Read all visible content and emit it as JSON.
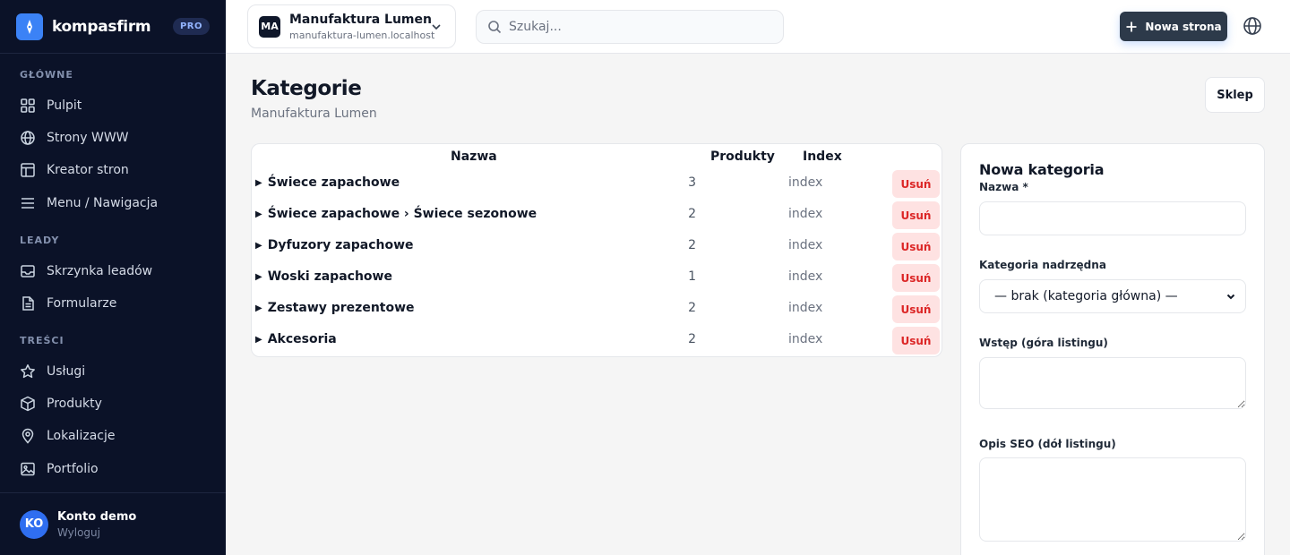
{
  "brand": {
    "name": "kompasfirm",
    "badge": "PRO"
  },
  "sidebar": {
    "sections": [
      {
        "title": "GŁÓWNE",
        "items": [
          {
            "label": "Pulpit",
            "icon": "grid-icon"
          },
          {
            "label": "Strony WWW",
            "icon": "globe-icon"
          },
          {
            "label": "Kreator stron",
            "icon": "layout-icon"
          },
          {
            "label": "Menu / Nawigacja",
            "icon": "menu-icon"
          }
        ]
      },
      {
        "title": "LEADY",
        "items": [
          {
            "label": "Skrzynka leadów",
            "icon": "inbox-icon"
          },
          {
            "label": "Formularze",
            "icon": "document-icon"
          }
        ]
      },
      {
        "title": "TREŚCI",
        "items": [
          {
            "label": "Usługi",
            "icon": "star-icon"
          },
          {
            "label": "Produkty",
            "icon": "box-icon"
          },
          {
            "label": "Lokalizacje",
            "icon": "map-pin-icon"
          },
          {
            "label": "Portfolio",
            "icon": "image-icon"
          }
        ]
      }
    ],
    "user": {
      "initials": "KO",
      "name": "Konto demo",
      "logout": "Wyloguj"
    }
  },
  "topbar": {
    "site": {
      "initials": "MA",
      "name": "Manufaktura Lumen",
      "domain": "manufaktura-lumen.localhost"
    },
    "search_placeholder": "Szukaj...",
    "new_page_label": "Nowa strona"
  },
  "page": {
    "title": "Kategorie",
    "subtitle": "Manufaktura Lumen",
    "shop_button": "Sklep"
  },
  "table": {
    "headers": {
      "name": "Nazwa",
      "products": "Produkty",
      "index": "Index"
    },
    "rows": [
      {
        "name": "Świece zapachowe",
        "products": "3",
        "index": "index",
        "action": "Usuń"
      },
      {
        "name": "Świece zapachowe › Świece sezonowe",
        "products": "2",
        "index": "index",
        "action": "Usuń"
      },
      {
        "name": "Dyfuzory zapachowe",
        "products": "2",
        "index": "index",
        "action": "Usuń"
      },
      {
        "name": "Woski zapachowe",
        "products": "1",
        "index": "index",
        "action": "Usuń"
      },
      {
        "name": "Zestawy prezentowe",
        "products": "2",
        "index": "index",
        "action": "Usuń"
      },
      {
        "name": "Akcesoria",
        "products": "2",
        "index": "index",
        "action": "Usuń"
      }
    ]
  },
  "form": {
    "title": "Nowa kategoria",
    "name_label": "Nazwa *",
    "name_value": "",
    "parent_label": "Kategoria nadrzędna",
    "parent_selected": "— brak (kategoria główna) —",
    "intro_label": "Wstęp (góra listingu)",
    "intro_value": "",
    "seo_label": "Opis SEO (dół listingu)",
    "seo_value": ""
  },
  "colors": {
    "sidebar_bg": "#0b1228",
    "accent": "#3b82f6",
    "danger": "#dc2626",
    "danger_bg": "#fee2e2"
  }
}
